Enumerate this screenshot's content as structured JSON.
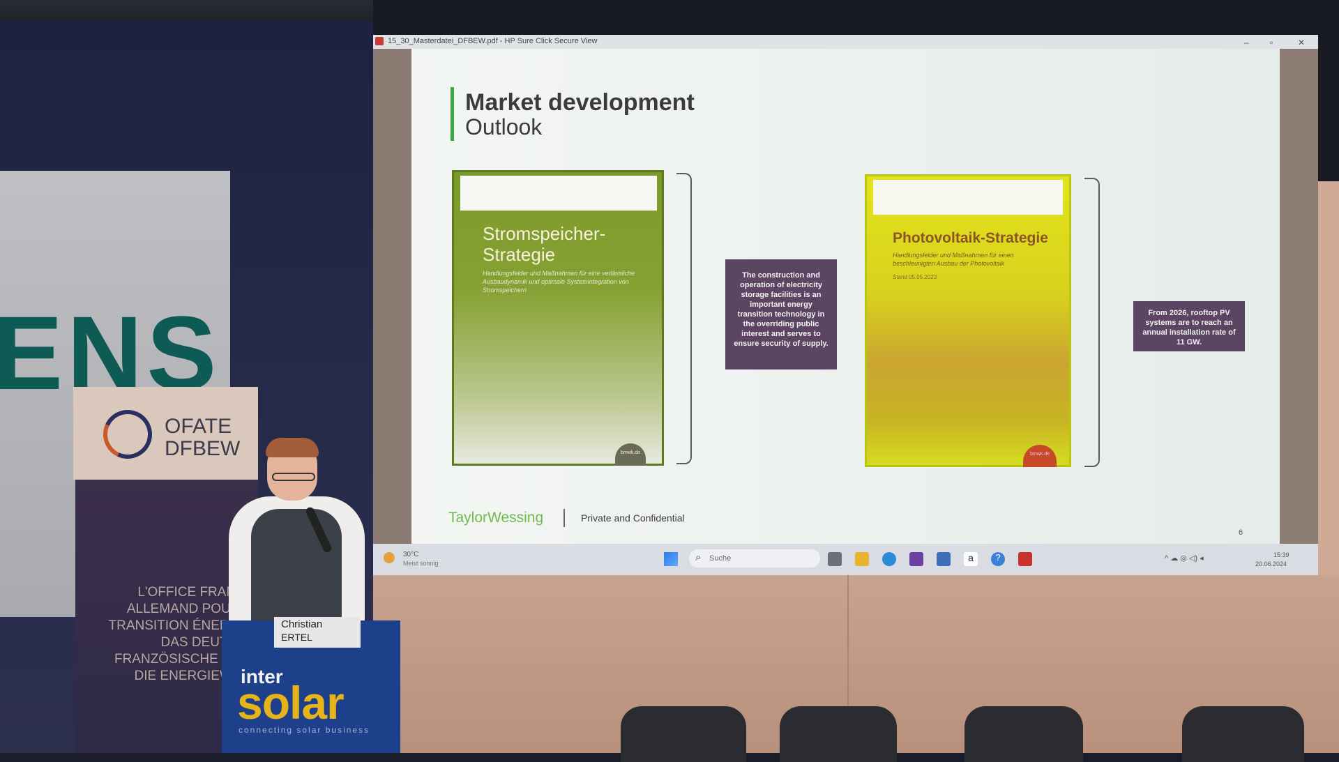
{
  "window": {
    "title": "15_30_Masterdatei_DFBEW.pdf - HP Sure Click Secure View",
    "controls": [
      "–",
      "▫",
      "✕"
    ]
  },
  "slide": {
    "title": "Market development",
    "subtitle": "Outlook",
    "left_cover": {
      "title_line1": "Stromspeicher-",
      "title_line2": "Strategie",
      "subtitle": "Handlungsfelder und Maßnahmen für eine verlässliche Ausbaudynamik und optimale Systemintegration von Stromspeichern",
      "badge": "bmwk.de"
    },
    "right_cover": {
      "title": "Photovoltaik-Strategie",
      "subtitle": "Handlungsfelder und Maßnahmen für einen beschleunigten Ausbau der Photovoltaik",
      "date": "Stand 05.05.2023",
      "badge": "bmwk.de"
    },
    "callout_left": "The construction and operation of electricity storage facilities is an important energy transition technology in the overriding public interest and serves to ensure security of supply.",
    "callout_right": "From 2026, rooftop PV systems are to reach an annual installation rate of 11 GW.",
    "footer_brand": "TaylorWessing",
    "footer_text": "Private and Confidential",
    "page_number": "6"
  },
  "taskbar": {
    "weather_temp": "30°C",
    "weather_desc": "Meist sonnig",
    "search_placeholder": "Suche",
    "tray": "^ ☁ ◎ ◁) ◂",
    "clock_time": "15:39",
    "clock_date": "20.06.2024"
  },
  "stage": {
    "sponsor_partial": "ENS",
    "ofate_line1": "OFATE",
    "ofate_line2": "DFBEW",
    "rollup_lines": [
      "L'OFFICE FRANCO-",
      "ALLEMAND POUR LA",
      "TRANSITION ÉNERGÉTI",
      "DAS DEUTSCH-",
      "FRANZÖSISCHE BÜRO",
      "DIE ENERGIEWEND"
    ],
    "speaker_first": "Christian",
    "speaker_last": "ERTEL",
    "podium_brand_top": "inter",
    "podium_brand_bottom": "solar",
    "podium_tagline": "connecting solar business"
  }
}
